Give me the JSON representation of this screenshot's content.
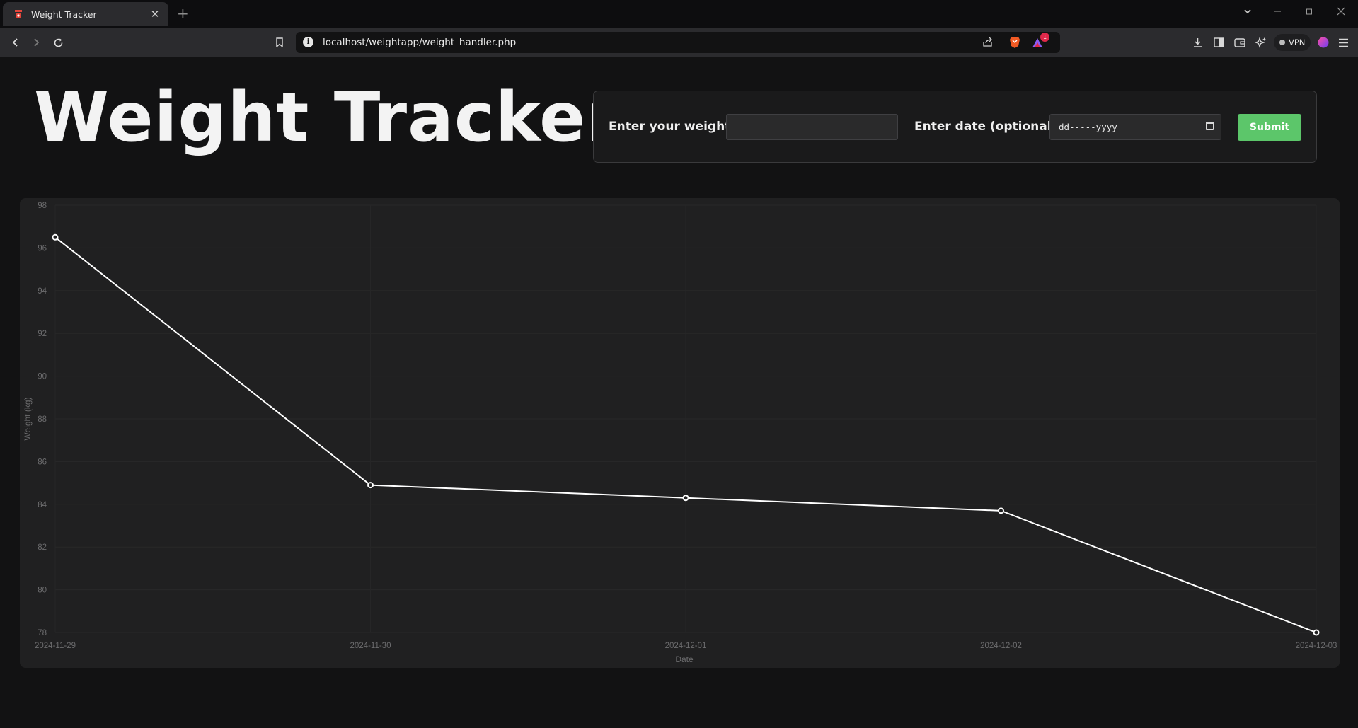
{
  "browser": {
    "tab_title": "Weight Tracker",
    "tab_close": "✕",
    "new_tab": "+",
    "url": "localhost/weightapp/weight_handler.php",
    "vpn_label": "VPN",
    "notification_count": "1",
    "icons": [
      "favicon-icon",
      "back-icon",
      "forward-icon",
      "reload-icon",
      "bookmark-icon",
      "info-icon",
      "share-icon",
      "brave-shield-icon",
      "rewards-icon",
      "download-icon",
      "sidebar-icon",
      "wallet-icon",
      "leo-icon",
      "vpn-icon",
      "profile-icon",
      "menu-icon",
      "tab-list-icon",
      "minimize-icon",
      "restore-icon",
      "close-icon"
    ]
  },
  "page": {
    "title": "Weight Tracker",
    "form": {
      "weight_label": "Enter your weight:",
      "weight_value": "",
      "date_label": "Enter date (optional):",
      "date_placeholder": "dd-----yyyy",
      "submit_label": "Submit"
    }
  },
  "colors": {
    "background": "#121213",
    "card": "#202021",
    "line": "#ffffff",
    "submit": "#5cc66a",
    "text": "#f3f3f3"
  },
  "chart_data": {
    "type": "line",
    "x": [
      "2024-11-29",
      "2024-11-30",
      "2024-12-01",
      "2024-12-02",
      "2024-12-03"
    ],
    "series": [
      {
        "values": [
          96.5,
          84.9,
          84.3,
          83.7,
          78
        ]
      }
    ],
    "xlabel": "Date",
    "ylabel": "Weight (kg)",
    "ylim": [
      78,
      98
    ],
    "yticks": [
      98,
      96,
      94,
      92,
      90,
      88,
      86,
      84,
      82,
      80,
      78
    ],
    "grid": true,
    "legend": "none"
  }
}
